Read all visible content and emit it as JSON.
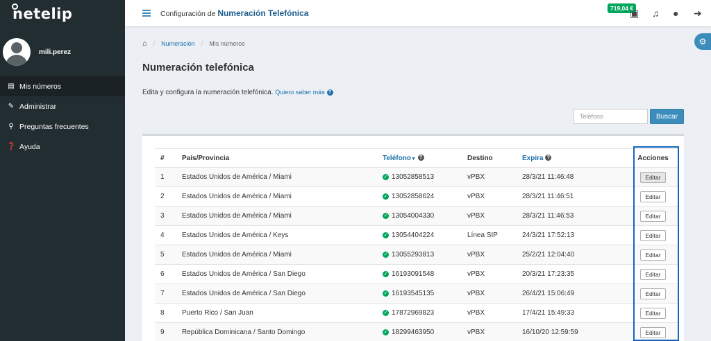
{
  "app": {
    "logo": "netelip"
  },
  "user": {
    "name": "mili.perez"
  },
  "sidebar": {
    "items": [
      {
        "label": "Mis números",
        "icon": "list-icon",
        "active": true
      },
      {
        "label": "Administrar",
        "icon": "edit-icon",
        "active": false
      },
      {
        "label": "Preguntas frecuentes",
        "icon": "search-icon",
        "active": false
      },
      {
        "label": "Ayuda",
        "icon": "question-icon",
        "active": false
      }
    ]
  },
  "topbar": {
    "prefix": "Configuración de",
    "title": "Numeración Telefónica",
    "balance": "719,04 €"
  },
  "breadcrumb": {
    "item1": "Numeración",
    "item2": "Mis números"
  },
  "page": {
    "title": "Numeración telefónica",
    "description": "Edita y configura la numeración telefónica.",
    "link": "Quiero saber más"
  },
  "search": {
    "placeholder": "Teléfono",
    "button": "Buscar"
  },
  "table": {
    "headers": {
      "num": "#",
      "country": "País/Provincia",
      "phone": "Teléfono",
      "dest": "Destino",
      "expires": "Expira",
      "actions": "Acciones"
    },
    "edit_label": "Editar",
    "rows": [
      {
        "n": "1",
        "country": "Estados Unidos de América / Miami",
        "phone": "13052858513",
        "dest": "vPBX",
        "expires": "28/3/21 11:46:48"
      },
      {
        "n": "2",
        "country": "Estados Unidos de América / Miami",
        "phone": "13052858624",
        "dest": "vPBX",
        "expires": "28/3/21 11:46:51"
      },
      {
        "n": "3",
        "country": "Estados Unidos de América / Miami",
        "phone": "13054004330",
        "dest": "vPBX",
        "expires": "28/3/21 11:46:53"
      },
      {
        "n": "4",
        "country": "Estados Unidos de América / Keys",
        "phone": "13054404224",
        "dest": "Línea SIP",
        "expires": "24/3/21 17:52:13"
      },
      {
        "n": "5",
        "country": "Estados Unidos de América / Miami",
        "phone": "13055293813",
        "dest": "vPBX",
        "expires": "25/2/21 12:04:40"
      },
      {
        "n": "6",
        "country": "Estados Unidos de América / San Diego",
        "phone": "16193091548",
        "dest": "vPBX",
        "expires": "20/3/21 17:23:35"
      },
      {
        "n": "7",
        "country": "Estados Unidos de América / San Diego",
        "phone": "16193545135",
        "dest": "vPBX",
        "expires": "26/4/21 15:06:49"
      },
      {
        "n": "8",
        "country": "Puerto Rico / San Juan",
        "phone": "17872969823",
        "dest": "vPBX",
        "expires": "17/4/21 15:49:33"
      },
      {
        "n": "9",
        "country": "República Dominicana / Santo Domingo",
        "phone": "18299463950",
        "dest": "vPBX",
        "expires": "16/10/20 12:59:59"
      }
    ]
  },
  "colors": {
    "sidebar": "#222d32",
    "accent": "#3c8dbc",
    "balance": "#00a65a",
    "highlight": "#1565c0"
  }
}
